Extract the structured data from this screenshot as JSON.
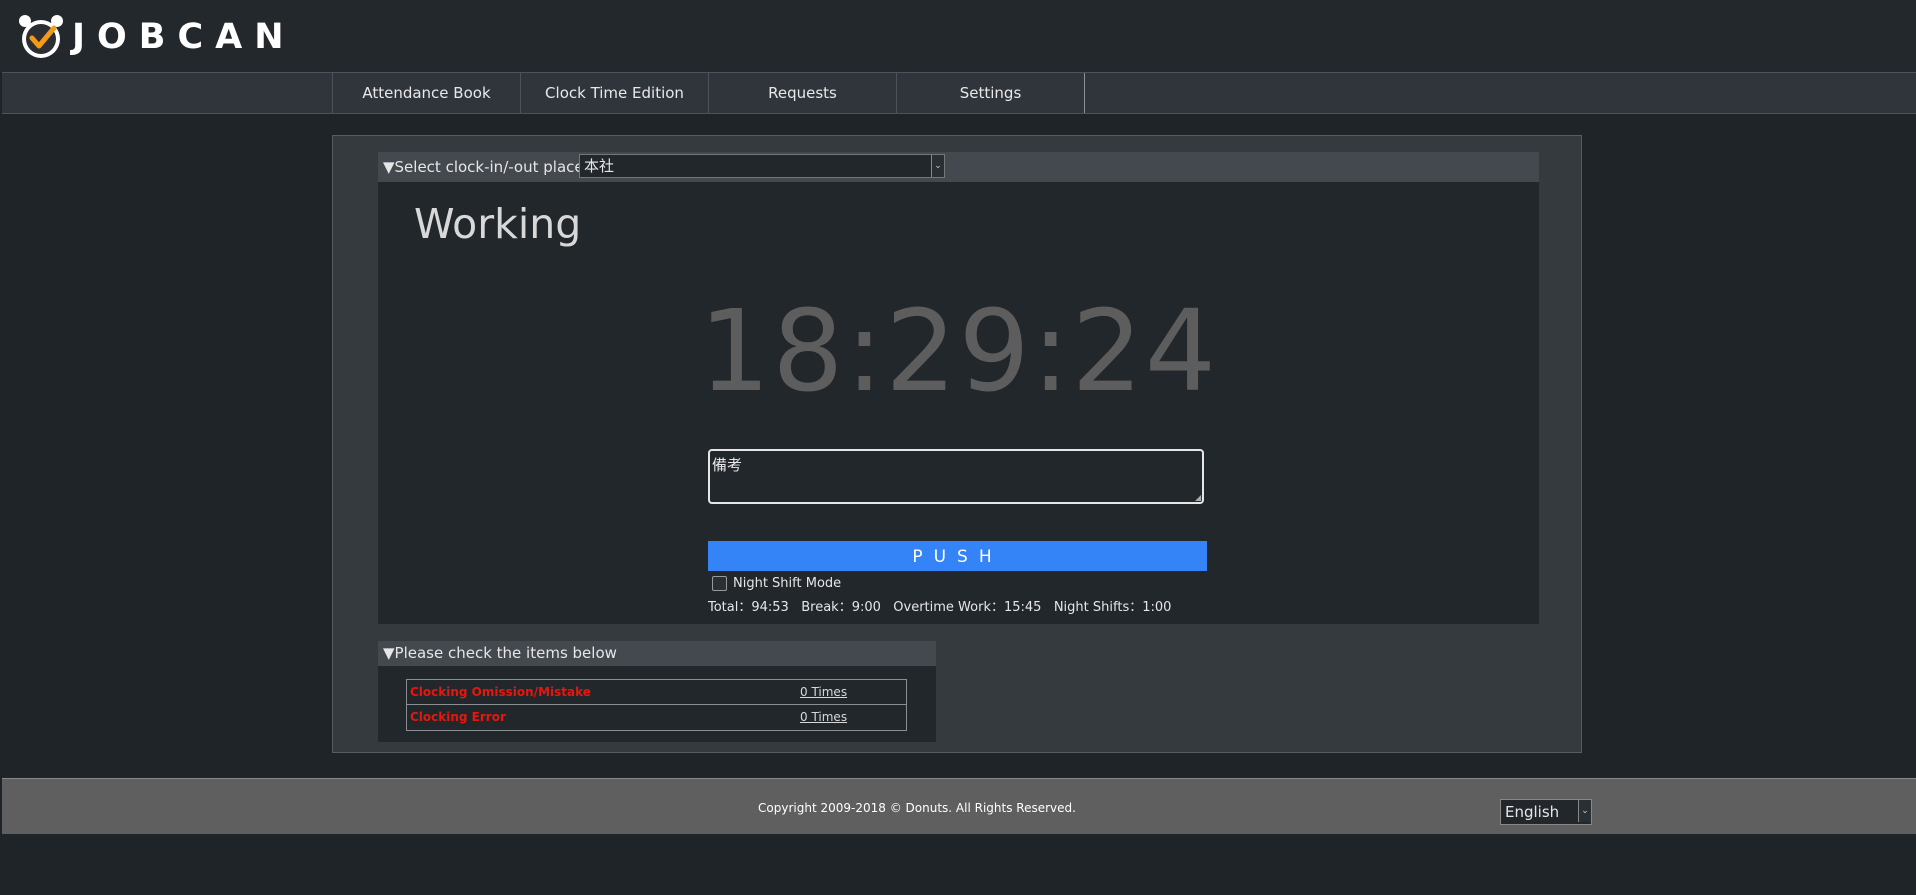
{
  "app": {
    "name": "JOBCAN"
  },
  "nav": {
    "items": [
      {
        "label": "Attendance Book"
      },
      {
        "label": "Clock Time Edition"
      },
      {
        "label": "Requests"
      },
      {
        "label": "Settings"
      }
    ]
  },
  "place": {
    "label": "▼Select clock-in/-out place",
    "selected": "本社"
  },
  "status": {
    "title": "Working",
    "clock": "18:29:24"
  },
  "note": {
    "value": "備考"
  },
  "push_label": "PUSH",
  "night_shift": {
    "label": "Night Shift Mode",
    "checked": false
  },
  "stats": {
    "text": "Total：94:53   Break：9:00   Overtime Work：15:45   Night Shifts：1:00"
  },
  "checks": {
    "header": "▼Please check the items below",
    "rows": [
      {
        "label": "Clocking Omission/Mistake",
        "value": "0 Times"
      },
      {
        "label": "Clocking Error",
        "value": "0 Times"
      }
    ]
  },
  "footer": {
    "copyright": "Copyright 2009-2018 © Donuts. All Rights Reserved.",
    "language": "English"
  },
  "colors": {
    "background": "#1f2429",
    "push_button": "#3483f7",
    "warning_text": "#e8160c",
    "logo_accent": "#f59a14"
  },
  "icons": {
    "logo": "alarm-clock-check-icon",
    "select_arrow": "chevron-down-icon"
  }
}
